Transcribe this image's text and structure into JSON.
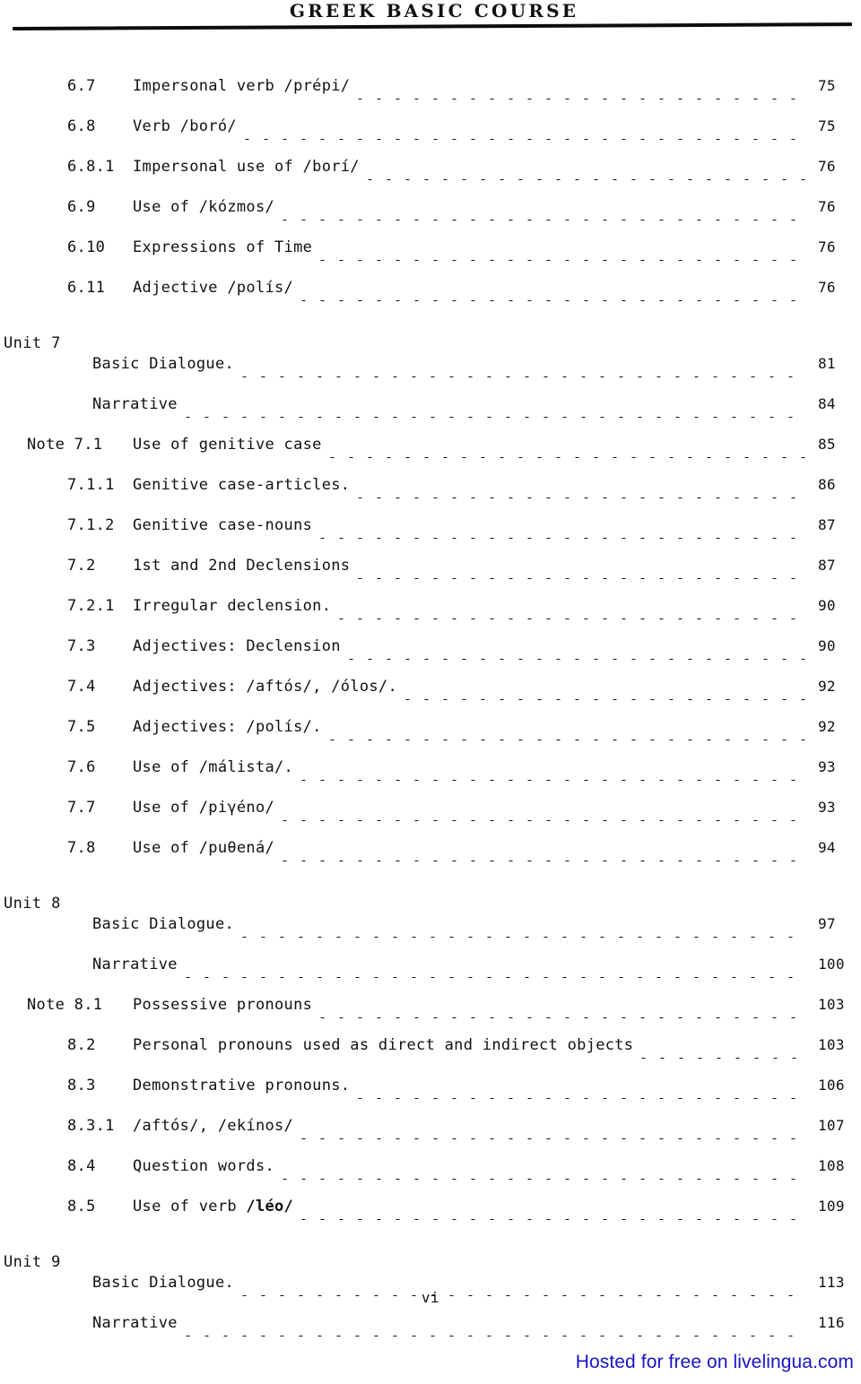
{
  "header": {
    "running_head": "GREEK BASIC COURSE"
  },
  "toc": {
    "blocks": [
      {
        "type": "entries",
        "rows": [
          {
            "indent": "num",
            "num": "6.7",
            "title": "Impersonal verb /prépi/",
            "page": "75"
          },
          {
            "indent": "num",
            "num": "6.8",
            "title": "Verb /boró/",
            "page": "75"
          },
          {
            "indent": "num",
            "num": "6.8.1",
            "title": "Impersonal use of /borí/",
            "page": "76"
          },
          {
            "indent": "num",
            "num": "6.9",
            "title": "Use of /kózmos/",
            "page": "76"
          },
          {
            "indent": "num",
            "num": "6.10",
            "title": "Expressions of Time",
            "page": "76"
          },
          {
            "indent": "num",
            "num": "6.11",
            "title": "Adjective /polís/",
            "page": "76"
          }
        ]
      },
      {
        "type": "unit",
        "label": "Unit 7",
        "rows": [
          {
            "indent": "plain",
            "num": "",
            "title": "Basic Dialogue.",
            "page": "81"
          },
          {
            "indent": "plain",
            "num": "",
            "title": "Narrative",
            "page": "84"
          },
          {
            "indent": "note",
            "num": "Note 7.1",
            "title": "Use of genitive case",
            "page": "85"
          },
          {
            "indent": "sub",
            "num": "7.1.1",
            "title": "Genitive case-articles.",
            "page": "86"
          },
          {
            "indent": "sub",
            "num": "7.1.2",
            "title": "Genitive case-nouns",
            "page": "87"
          },
          {
            "indent": "sub",
            "num": "7.2",
            "title": "1st and 2nd Declensions",
            "page": "87"
          },
          {
            "indent": "sub",
            "num": "7.2.1",
            "title": "Irregular declension.",
            "page": "90"
          },
          {
            "indent": "sub",
            "num": "7.3",
            "title": "Adjectives:  Declension",
            "page": "90"
          },
          {
            "indent": "sub",
            "num": "7.4",
            "title": "Adjectives:  /aftós/, /ólos/.",
            "page": "92"
          },
          {
            "indent": "sub",
            "num": "7.5",
            "title": "Adjectives:  /polís/.",
            "page": "92"
          },
          {
            "indent": "sub",
            "num": "7.6",
            "title": "Use of /málista/.",
            "page": "93"
          },
          {
            "indent": "sub",
            "num": "7.7",
            "title": "Use of /piγéno/",
            "page": "93"
          },
          {
            "indent": "sub",
            "num": "7.8",
            "title": "Use of /puθená/",
            "page": "94"
          }
        ]
      },
      {
        "type": "unit",
        "label": "Unit 8",
        "rows": [
          {
            "indent": "plain",
            "num": "",
            "title": "Basic Dialogue.",
            "page": "97"
          },
          {
            "indent": "plain",
            "num": "",
            "title": "Narrative",
            "page": "100"
          },
          {
            "indent": "note",
            "num": "Note 8.1",
            "title": "Possessive pronouns",
            "page": "103"
          },
          {
            "indent": "sub",
            "num": "8.2",
            "title": "Personal pronouns used as direct and indirect objects",
            "page": "103"
          },
          {
            "indent": "sub",
            "num": "8.3",
            "title": "Demonstrative pronouns.",
            "page": "106"
          },
          {
            "indent": "sub",
            "num": "8.3.1",
            "title": "/aftós/, /ekínos/",
            "page": "107"
          },
          {
            "indent": "sub",
            "num": "8.4",
            "title": "Question words.",
            "page": "108"
          },
          {
            "indent": "sub",
            "num": "8.5",
            "title": "Use of verb ",
            "title_bold": "/léo/",
            "page": "109"
          }
        ]
      },
      {
        "type": "unit",
        "label": "Unit 9",
        "rows": [
          {
            "indent": "plain",
            "num": "",
            "title": "Basic Dialogue.",
            "page": "113"
          },
          {
            "indent": "plain",
            "num": "",
            "title": "Narrative",
            "page": "116"
          }
        ]
      }
    ]
  },
  "footer": {
    "folio": "vi",
    "hosted_notice": "Hosted for free on livelingua.com",
    "hosted_color": "#1a14c8"
  }
}
